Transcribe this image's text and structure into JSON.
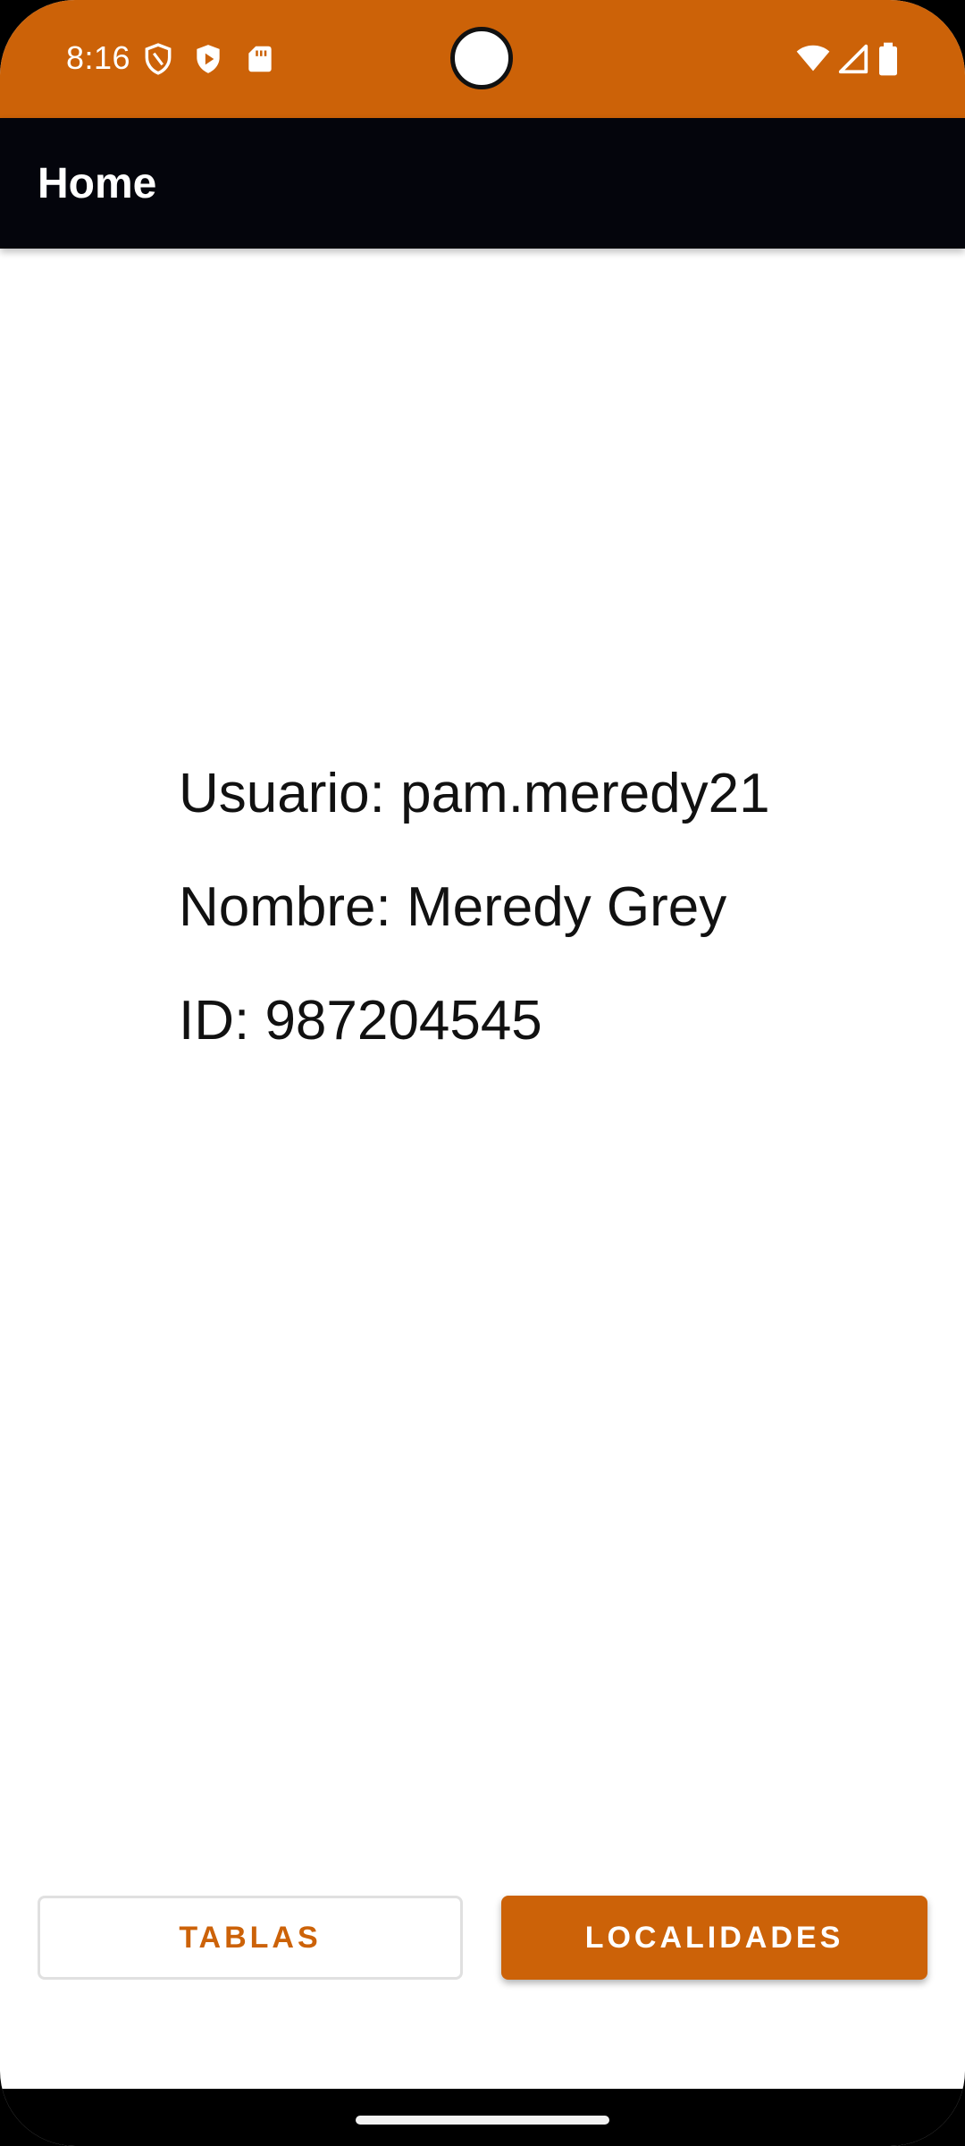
{
  "status_bar": {
    "time": "8:16",
    "icons_left": [
      "shield-icon",
      "play-store-icon",
      "sd-card-icon"
    ],
    "icons_right": [
      "wifi-icon",
      "signal-icon",
      "battery-icon"
    ]
  },
  "app_bar": {
    "title": "Home"
  },
  "user_info": {
    "usuario": "Usuario: pam.meredy21",
    "nombre": "Nombre: Meredy Grey",
    "id": "ID: 987204545"
  },
  "actions": {
    "tablas_label": "TABLAS",
    "localidades_label": "LOCALIDADES"
  },
  "colors": {
    "accent": "#CC6208",
    "app_bar": "#04050C",
    "background": "#FFFFFF"
  }
}
